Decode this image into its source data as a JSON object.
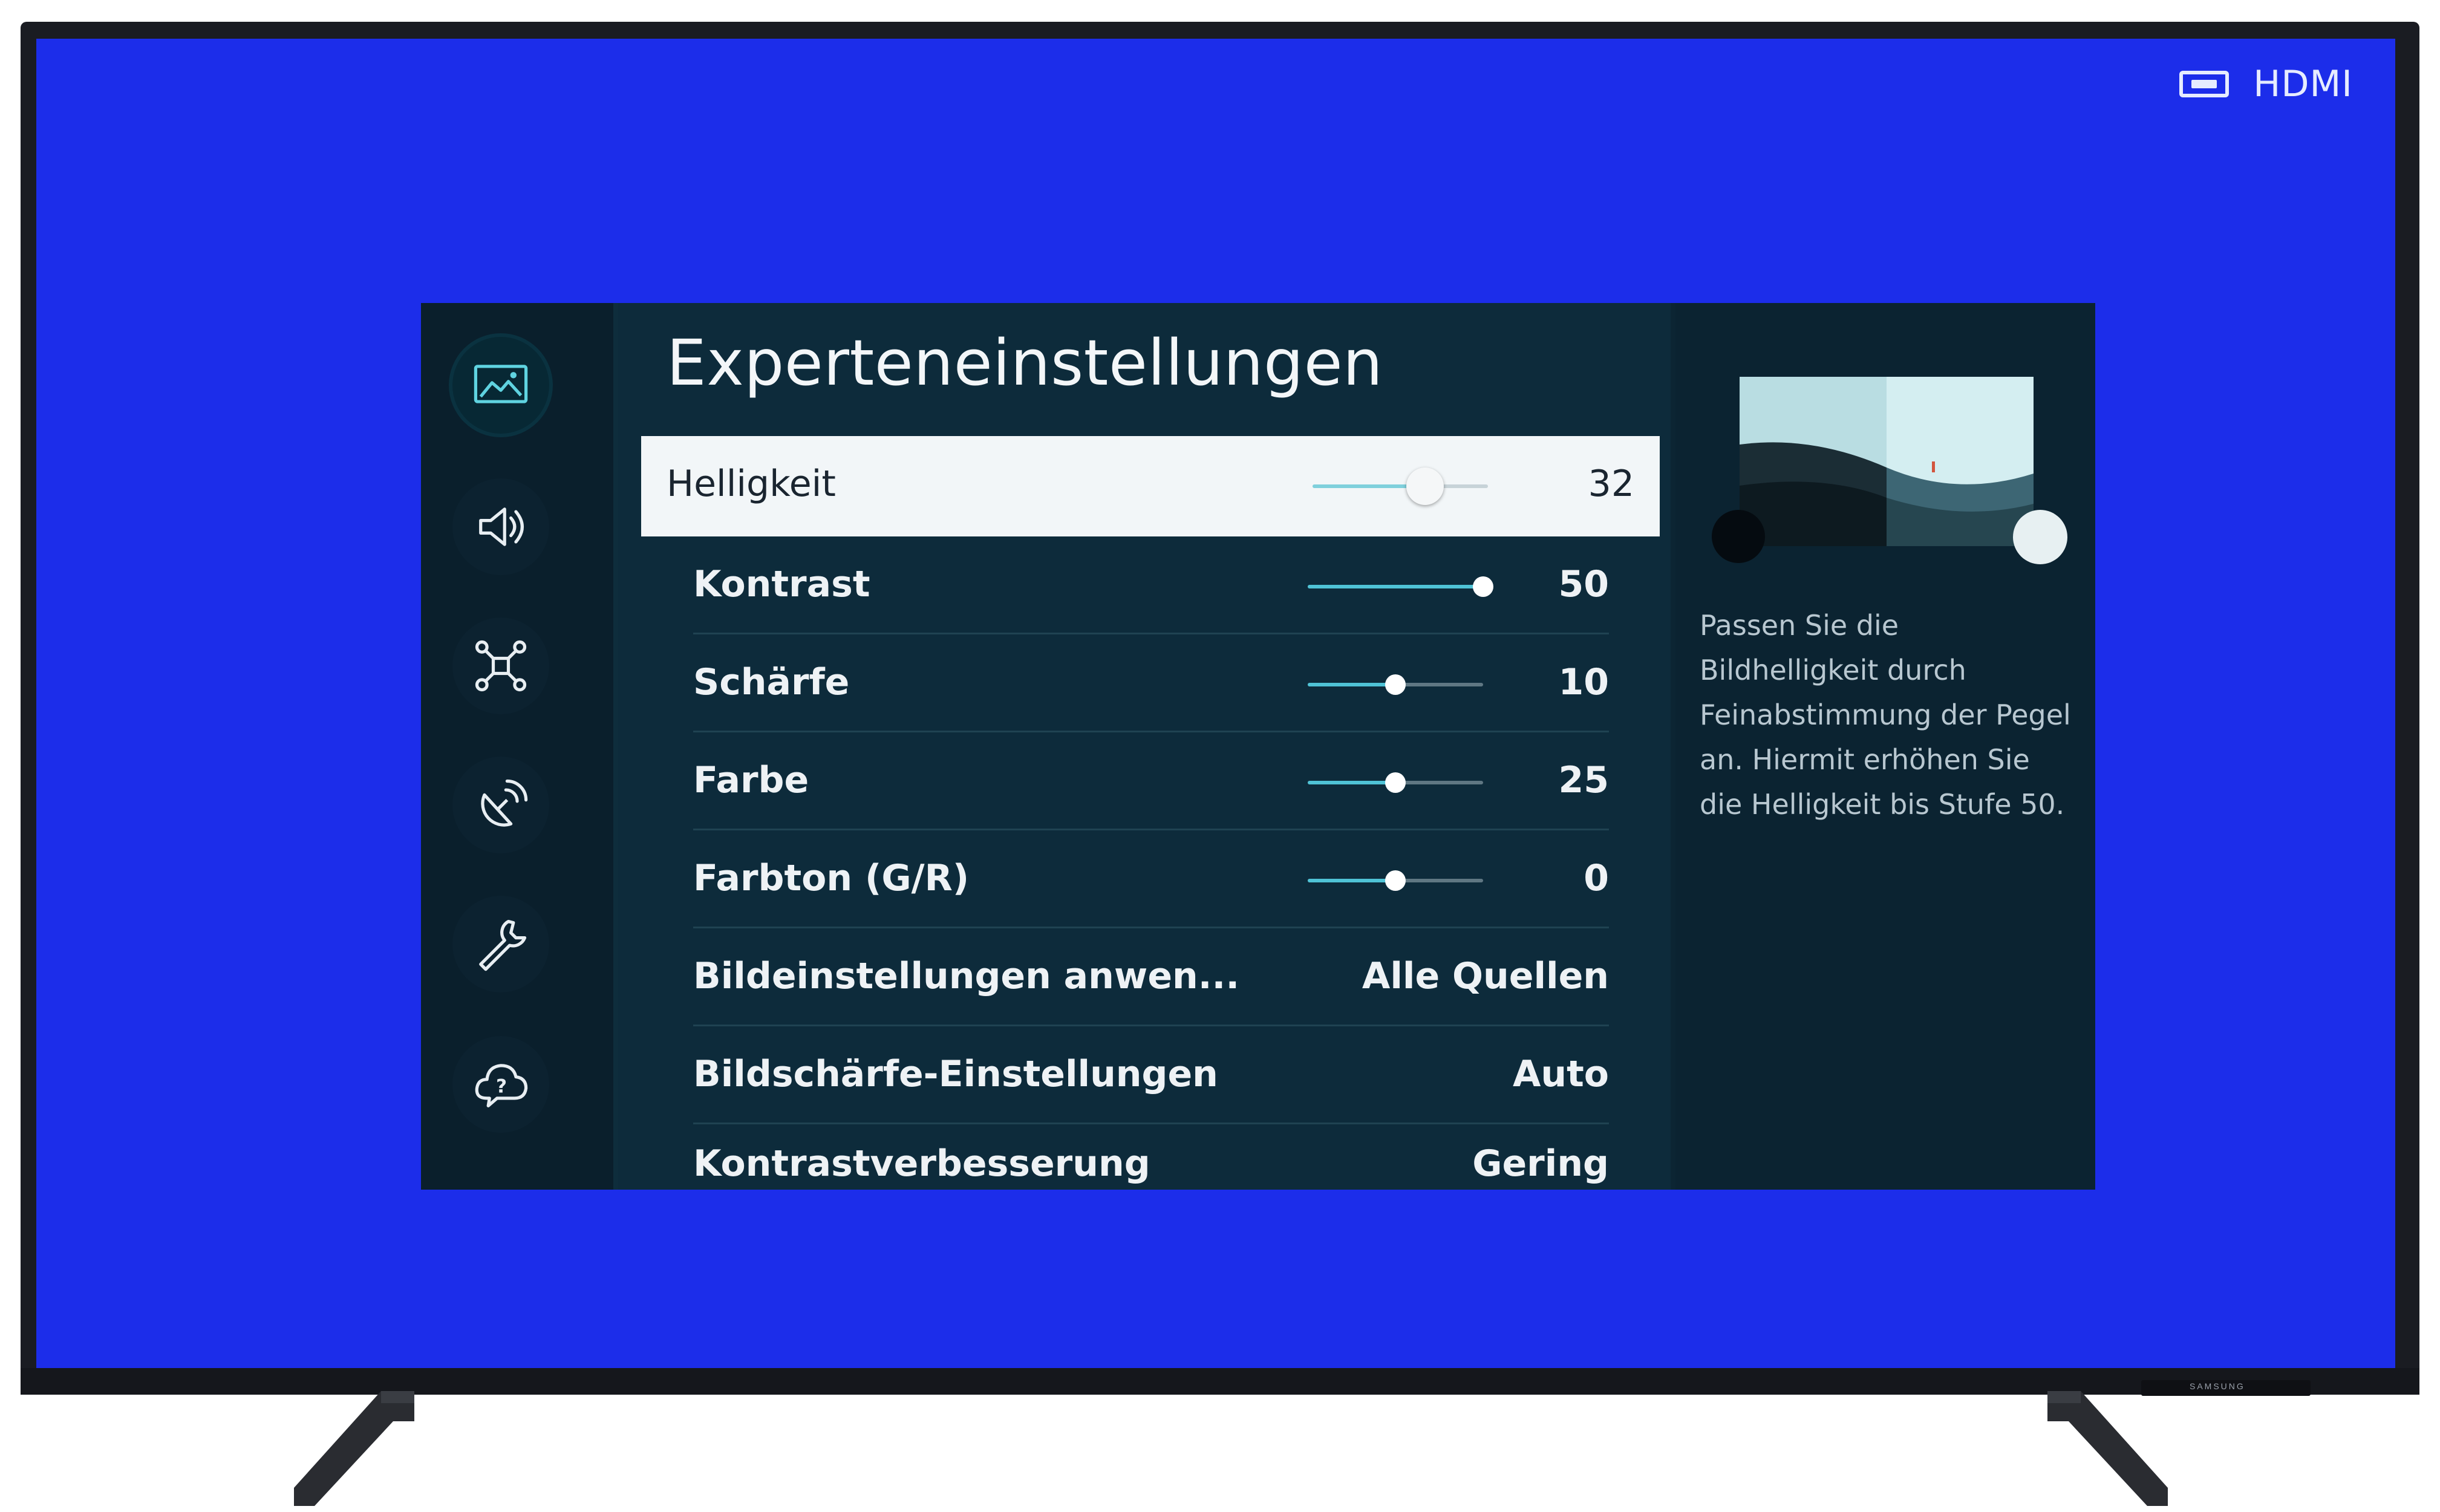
{
  "source": {
    "icon": "hdmi-input-icon",
    "label": "HDMI"
  },
  "brand": "SAMSUNG",
  "sidebar": {
    "items": [
      {
        "icon": "picture-icon",
        "active": true
      },
      {
        "icon": "sound-icon",
        "active": false
      },
      {
        "icon": "connection-icon",
        "active": false
      },
      {
        "icon": "broadcast-icon",
        "active": false
      },
      {
        "icon": "tools-icon",
        "active": false
      },
      {
        "icon": "support-icon",
        "active": false
      }
    ]
  },
  "main": {
    "title": "Experteneinstellungen",
    "settings": [
      {
        "label": "Helligkeit",
        "value": "32",
        "slider": 0.64
      },
      {
        "label": "Kontrast",
        "value": "50",
        "slider": 1.0
      },
      {
        "label": "Schärfe",
        "value": "10",
        "slider": 0.5
      },
      {
        "label": "Farbe",
        "value": "25",
        "slider": 0.5
      },
      {
        "label": "Farbton (G/R)",
        "value": "0",
        "slider": 0.5
      },
      {
        "label": "Bildeinstellungen anwen...",
        "value": "Alle Quellen"
      },
      {
        "label": "Bildschärfe-Einstellungen",
        "value": "Auto"
      },
      {
        "label": "Kontrastverbesserung",
        "value": "Gering"
      }
    ]
  },
  "help": {
    "text": "Passen Sie die Bildhelligkeit durch Feinabstimmung der Pegel an. Hiermit erhöhen Sie die Helligkeit bis Stufe 50."
  },
  "colors": {
    "screen_background": "#1c2dea",
    "menu_background": "#0d2b3b",
    "accent": "#4fc3d6",
    "focus_row": "#f2f6f8"
  }
}
